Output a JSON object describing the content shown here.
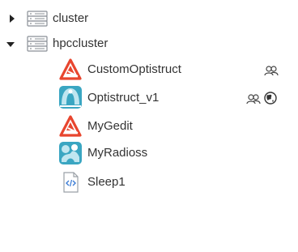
{
  "tree": {
    "nodes": [
      {
        "label": "cluster",
        "expanded": false,
        "icon": "server-icon",
        "children": []
      },
      {
        "label": "hpccluster",
        "expanded": true,
        "icon": "server-icon",
        "children": [
          {
            "label": "CustomOptistruct",
            "icon": "altair-logo-icon",
            "badges": [
              "shared-users-icon"
            ]
          },
          {
            "label": "Optistruct_v1",
            "icon": "optistruct-app-icon",
            "badges": [
              "shared-users-icon",
              "public-globe-icon"
            ]
          },
          {
            "label": "MyGedit",
            "icon": "altair-logo-icon",
            "badges": []
          },
          {
            "label": "MyRadioss",
            "icon": "radioss-app-icon",
            "badges": []
          },
          {
            "label": "Sleep1",
            "icon": "script-file-icon",
            "badges": []
          }
        ]
      }
    ]
  },
  "colors": {
    "altair_red": "#e8452e",
    "teal": "#3aa6c2",
    "server_gray": "#8a8f96",
    "text": "#333333"
  }
}
